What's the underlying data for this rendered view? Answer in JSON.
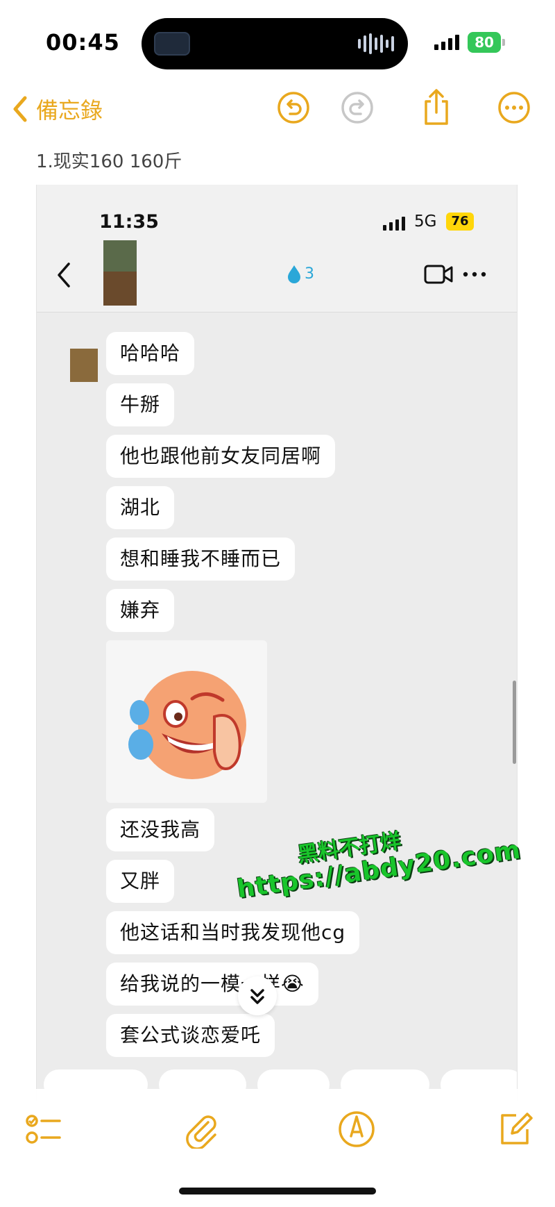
{
  "status_bar": {
    "time": "00:45",
    "battery": "80"
  },
  "notes": {
    "back_label": "備忘錄",
    "title_line": "1.现实160 160斤",
    "icons": [
      "undo-icon",
      "redo-icon",
      "share-icon",
      "more-icon"
    ]
  },
  "screenshot": {
    "status_time": "11:35",
    "network": "5G",
    "battery": "76",
    "streak": "3",
    "messages": [
      "哈哈哈",
      "牛掰",
      "他也跟他前女友同居啊",
      "湖北",
      "想和睡我不睡而已",
      "嫌弃",
      "还没我高",
      "又胖",
      "他这话和当时我发现他cg",
      "给我说的一模一样😭",
      "套公式谈恋爱吒"
    ]
  },
  "watermark": {
    "line1": "黑料不打烊",
    "line2": "https://abdy20.com"
  },
  "bottom_toolbar": {
    "icons": [
      "checklist-icon",
      "attachment-icon",
      "markup-icon",
      "compose-icon"
    ]
  },
  "colors": {
    "accent": "#e9a81e",
    "battery_green": "#34c759",
    "watermark": "#19c52b"
  }
}
